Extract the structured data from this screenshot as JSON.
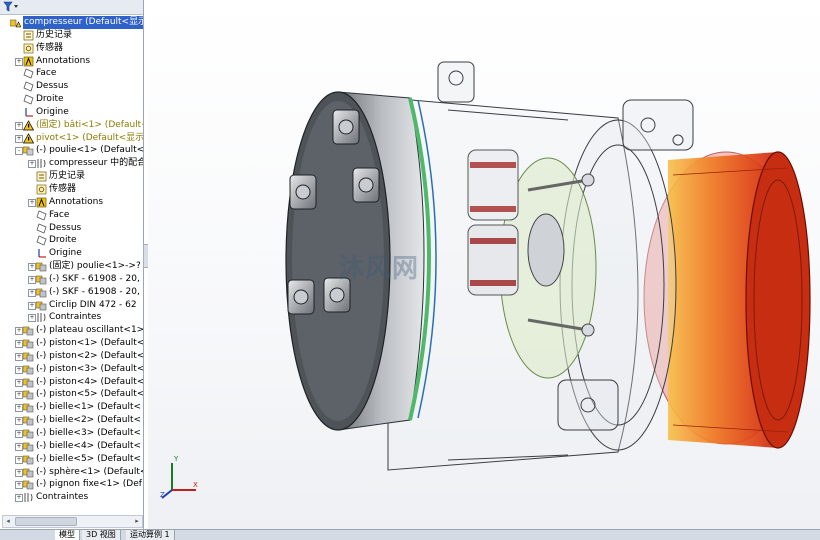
{
  "tree": {
    "items": [
      {
        "label": "compresseur  (Default<显示",
        "depth": 0,
        "expander": "",
        "icon": "assembly-warning-icon",
        "selected": true,
        "warn": false
      },
      {
        "label": "历史记录",
        "depth": 1,
        "expander": "",
        "icon": "history-icon",
        "selected": false,
        "warn": false
      },
      {
        "label": "传感器",
        "depth": 1,
        "expander": "",
        "icon": "sensor-icon",
        "selected": false,
        "warn": false
      },
      {
        "label": "Annotations",
        "depth": 1,
        "expander": "+",
        "icon": "annotations-icon",
        "selected": false,
        "warn": false
      },
      {
        "label": "Face",
        "depth": 1,
        "expander": "",
        "icon": "plane-icon",
        "selected": false,
        "warn": false
      },
      {
        "label": "Dessus",
        "depth": 1,
        "expander": "",
        "icon": "plane-icon",
        "selected": false,
        "warn": false
      },
      {
        "label": "Droite",
        "depth": 1,
        "expander": "",
        "icon": "plane-icon",
        "selected": false,
        "warn": false
      },
      {
        "label": "Origine",
        "depth": 1,
        "expander": "",
        "icon": "origin-icon",
        "selected": false,
        "warn": false
      },
      {
        "label": "(固定) bâti<1> (Default<",
        "depth": 1,
        "expander": "+",
        "icon": "part-warning-icon",
        "selected": false,
        "warn": true
      },
      {
        "label": "pivot<1> (Default<显示",
        "depth": 1,
        "expander": "+",
        "icon": "part-warning-icon",
        "selected": false,
        "warn": true
      },
      {
        "label": "(-) poulie<1> (Default<",
        "depth": 1,
        "expander": "-",
        "icon": "subassembly-icon",
        "selected": false,
        "warn": false
      },
      {
        "label": "compresseur 中的配合",
        "depth": 2,
        "expander": "+",
        "icon": "mates-icon",
        "selected": false,
        "warn": false
      },
      {
        "label": "历史记录",
        "depth": 2,
        "expander": "",
        "icon": "history-icon",
        "selected": false,
        "warn": false
      },
      {
        "label": "传感器",
        "depth": 2,
        "expander": "",
        "icon": "sensor-icon",
        "selected": false,
        "warn": false
      },
      {
        "label": "Annotations",
        "depth": 2,
        "expander": "+",
        "icon": "annotations-icon",
        "selected": false,
        "warn": false
      },
      {
        "label": "Face",
        "depth": 2,
        "expander": "",
        "icon": "plane-icon",
        "selected": false,
        "warn": false
      },
      {
        "label": "Dessus",
        "depth": 2,
        "expander": "",
        "icon": "plane-icon",
        "selected": false,
        "warn": false
      },
      {
        "label": "Droite",
        "depth": 2,
        "expander": "",
        "icon": "plane-icon",
        "selected": false,
        "warn": false
      },
      {
        "label": "Origine",
        "depth": 2,
        "expander": "",
        "icon": "origin-icon",
        "selected": false,
        "warn": false
      },
      {
        "label": "(固定) poulie<1>->?",
        "depth": 2,
        "expander": "+",
        "icon": "part-icon",
        "selected": false,
        "warn": false
      },
      {
        "label": "(-) SKF - 61908 - 20,",
        "depth": 2,
        "expander": "+",
        "icon": "part-icon",
        "selected": false,
        "warn": false
      },
      {
        "label": "(-) SKF - 61908 - 20,",
        "depth": 2,
        "expander": "+",
        "icon": "part-icon",
        "selected": false,
        "warn": false
      },
      {
        "label": "Circlip DIN 472 - 62",
        "depth": 2,
        "expander": "+",
        "icon": "part-icon",
        "selected": false,
        "warn": false
      },
      {
        "label": "Contraintes",
        "depth": 2,
        "expander": "+",
        "icon": "mates-icon",
        "selected": false,
        "warn": false
      },
      {
        "label": "(-) plateau oscillant<1>",
        "depth": 1,
        "expander": "+",
        "icon": "part-icon",
        "selected": false,
        "warn": false
      },
      {
        "label": "(-) piston<1> (Default<",
        "depth": 1,
        "expander": "+",
        "icon": "part-icon",
        "selected": false,
        "warn": false
      },
      {
        "label": "(-) piston<2> (Default<",
        "depth": 1,
        "expander": "+",
        "icon": "part-icon",
        "selected": false,
        "warn": false
      },
      {
        "label": "(-) piston<3> (Default<",
        "depth": 1,
        "expander": "+",
        "icon": "part-icon",
        "selected": false,
        "warn": false
      },
      {
        "label": "(-) piston<4> (Default<",
        "depth": 1,
        "expander": "+",
        "icon": "part-icon",
        "selected": false,
        "warn": false
      },
      {
        "label": "(-) piston<5> (Default<",
        "depth": 1,
        "expander": "+",
        "icon": "part-icon",
        "selected": false,
        "warn": false
      },
      {
        "label": "(-) bielle<1> (Default<",
        "depth": 1,
        "expander": "+",
        "icon": "part-icon",
        "selected": false,
        "warn": false
      },
      {
        "label": "(-) bielle<2> (Default<",
        "depth": 1,
        "expander": "+",
        "icon": "part-icon",
        "selected": false,
        "warn": false
      },
      {
        "label": "(-) bielle<3> (Default<",
        "depth": 1,
        "expander": "+",
        "icon": "part-icon",
        "selected": false,
        "warn": false
      },
      {
        "label": "(-) bielle<4> (Default<",
        "depth": 1,
        "expander": "+",
        "icon": "part-icon",
        "selected": false,
        "warn": false
      },
      {
        "label": "(-) bielle<5> (Default<",
        "depth": 1,
        "expander": "+",
        "icon": "part-icon",
        "selected": false,
        "warn": false
      },
      {
        "label": "(-) sphère<1> (Default<",
        "depth": 1,
        "expander": "+",
        "icon": "part-icon",
        "selected": false,
        "warn": false
      },
      {
        "label": "(-) pignon fixe<1> (Def",
        "depth": 1,
        "expander": "+",
        "icon": "part-icon",
        "selected": false,
        "warn": false
      },
      {
        "label": "Contraintes",
        "depth": 1,
        "expander": "+",
        "icon": "mates-icon",
        "selected": false,
        "warn": false
      }
    ]
  },
  "tabs": [
    {
      "label": "模型",
      "active": true
    },
    {
      "label": "3D 视图",
      "active": false
    },
    {
      "label": "运动算例 1",
      "active": false
    }
  ],
  "viewport": {
    "watermark": "沐风网",
    "triad": {
      "x": "X",
      "y": "Y",
      "z": "Z"
    }
  },
  "colors": {
    "selection": "#2f62c9",
    "pulley": "#e8541a",
    "seal_ring": "#4fb86a"
  }
}
